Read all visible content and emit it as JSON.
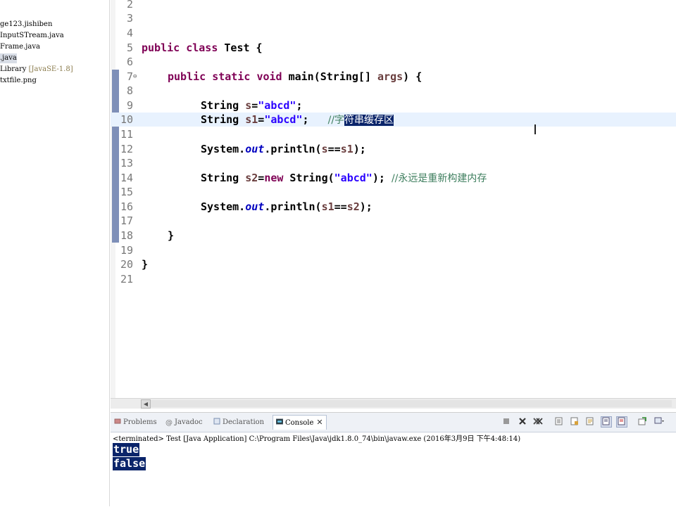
{
  "explorer": {
    "items": [
      {
        "label": "ge123.jishiben",
        "selected": false
      },
      {
        "label": "InputSTream.java",
        "selected": false
      },
      {
        "label": "Frame.java",
        "selected": false
      },
      {
        "label": ".java",
        "selected": true
      },
      {
        "label": " Library ",
        "suffix": "[JavaSE-1.8]",
        "selected": false
      },
      {
        "label": "txtfile.png",
        "selected": false
      }
    ]
  },
  "editor": {
    "line_numbers": [
      "2",
      "3",
      "4",
      "5",
      "6",
      "7",
      "8",
      "9",
      "10",
      "11",
      "12",
      "13",
      "14",
      "15",
      "16",
      "17",
      "18",
      "19",
      "20",
      "21"
    ],
    "current_line": "10",
    "code": {
      "l5_kw1": "public",
      "l5_kw2": "class",
      "l5_rest": " Test {",
      "l7_kw1": "public",
      "l7_kw2": "static",
      "l7_kw3": "void",
      "l7_mid": " main(String[] ",
      "l7_var": "args",
      "l7_end": ") {",
      "l9_type": "String ",
      "l9_var": "s",
      "l9_eq": "=",
      "l9_str": "\"abcd\"",
      "l9_end": ";",
      "l10_type": "String ",
      "l10_var": "s1",
      "l10_eq": "=",
      "l10_str": "\"abcd\"",
      "l10_end": ";   ",
      "l10_cmt_a": "//字",
      "l10_cmt_sel": "符串缓存区",
      "l12_a": "System.",
      "l12_fld": "out",
      "l12_b": ".println(",
      "l12_v1": "s",
      "l12_op": "==",
      "l12_v2": "s1",
      "l12_c": ");",
      "l14_type": "String ",
      "l14_var": "s2",
      "l14_eq": "=",
      "l14_kw": "new",
      "l14_b": " String(",
      "l14_str": "\"abcd\"",
      "l14_c": "); ",
      "l14_cmt": "//永远是重新构建内存",
      "l16_a": "System.",
      "l16_fld": "out",
      "l16_b": ".println(",
      "l16_v1": "s1",
      "l16_op": "==",
      "l16_v2": "s2",
      "l16_c": ");",
      "l18": "}",
      "l20": "}"
    }
  },
  "views": {
    "tabs": [
      {
        "label": "Problems",
        "icon": "problems-icon",
        "active": false
      },
      {
        "label": "Javadoc",
        "icon": "javadoc-icon",
        "active": false
      },
      {
        "label": "Declaration",
        "icon": "declaration-icon",
        "active": false
      },
      {
        "label": "Console",
        "icon": "console-icon",
        "active": true
      }
    ],
    "close_glyph": "✕",
    "toolbar": [
      "terminate-icon",
      "remove-launch-icon",
      "remove-all-icon",
      "clear-console-icon",
      "scroll-lock-icon",
      "word-wrap-icon",
      "show-on-output-icon",
      "show-on-error-icon",
      "pin-console-icon",
      "display-selected-console-icon"
    ],
    "console": {
      "header": "<terminated> Test [Java Application] C:\\Program Files\\Java\\jdk1.8.0_74\\bin\\javaw.exe (2016年3月9日 下午4:48:14)",
      "output": [
        "true",
        "false"
      ]
    }
  },
  "colors": {
    "keyword": "#7f0055",
    "string": "#2a00ff",
    "comment": "#3f7f5f",
    "local_var": "#6a3e3e",
    "field": "#0000c0",
    "selection": "#0a246a",
    "current_line": "#e8f2fe"
  }
}
